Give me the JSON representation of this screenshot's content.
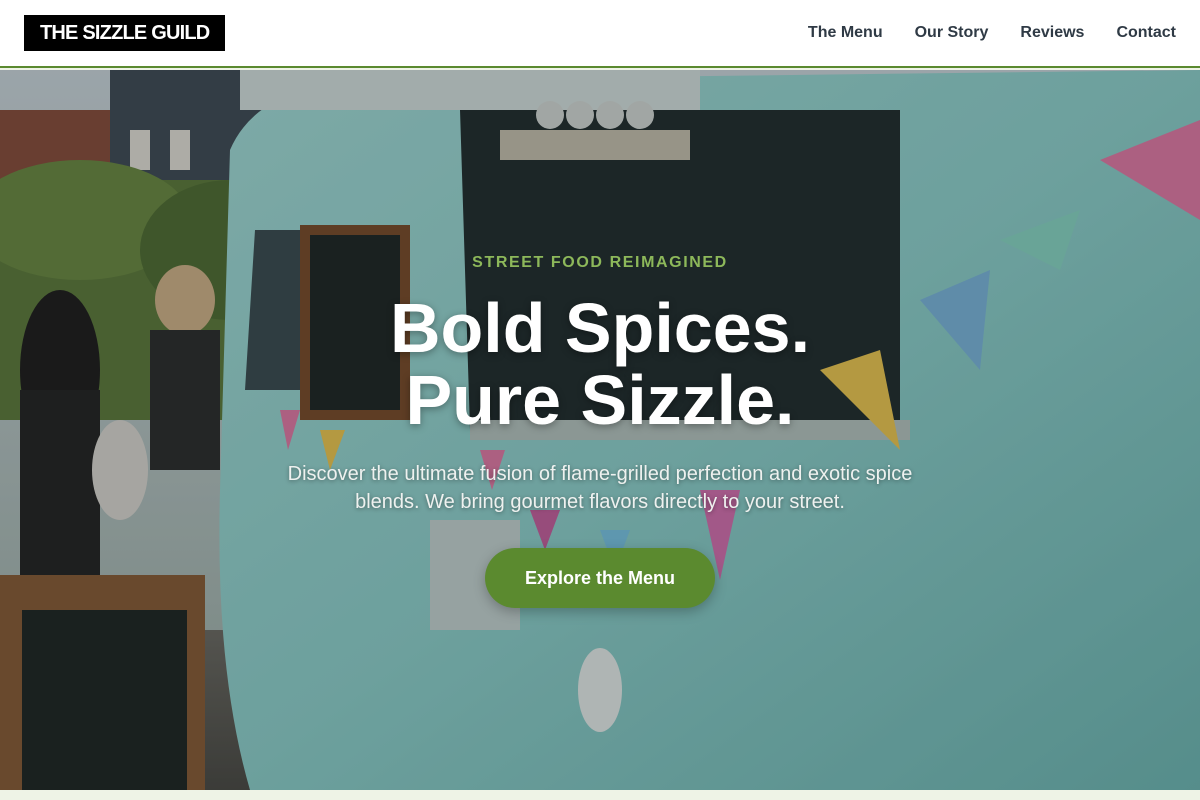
{
  "header": {
    "logo_text": "THE SIZZLE GUILD",
    "nav": [
      {
        "label": "The Menu"
      },
      {
        "label": "Our Story"
      },
      {
        "label": "Reviews"
      },
      {
        "label": "Contact"
      }
    ]
  },
  "hero": {
    "eyebrow": "STREET FOOD REIMAGINED",
    "headline_line1": "Bold Spices.",
    "headline_line2": "Pure Sizzle.",
    "subtext": "Discover the ultimate fusion of flame-grilled perfection and exotic spice blends. We bring gourmet flavors directly to your street.",
    "cta_label": "Explore the Menu"
  },
  "colors": {
    "accent_green": "#5b8a2f",
    "eyebrow_green": "#8db85a",
    "logo_bg": "#000000",
    "van_teal": "#8fd3cf"
  }
}
